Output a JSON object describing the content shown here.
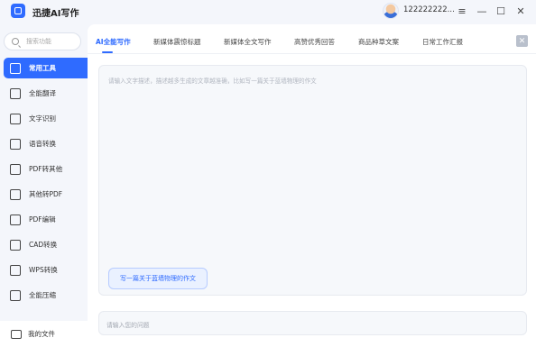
{
  "app": {
    "title": "迅捷AI写作"
  },
  "user": {
    "name": "122222222..."
  },
  "window_controls": {
    "menu": "≡",
    "minimize": "—",
    "maximize": "☐",
    "close": "✕"
  },
  "search": {
    "placeholder": "搜索功能"
  },
  "sidebar": {
    "items": [
      {
        "label": "常用工具",
        "icon": "toolbox-icon",
        "active": true
      },
      {
        "label": "全能翻译",
        "icon": "translate-icon"
      },
      {
        "label": "文字识别",
        "icon": "ocr-icon"
      },
      {
        "label": "语音转换",
        "icon": "voice-icon"
      },
      {
        "label": "PDF转其他",
        "icon": "pdf-icon"
      },
      {
        "label": "其他转PDF",
        "icon": "to-pdf-icon"
      },
      {
        "label": "PDF编辑",
        "icon": "pdf-edit-icon"
      },
      {
        "label": "CAD转换",
        "icon": "cad-icon"
      },
      {
        "label": "WPS转换",
        "icon": "wps-icon"
      },
      {
        "label": "全能压缩",
        "icon": "compress-icon"
      }
    ],
    "my_files": "我的文件"
  },
  "tabs": [
    {
      "label": "AI全能写作",
      "active": true
    },
    {
      "label": "新媒体震惊标题"
    },
    {
      "label": "新媒体全文写作"
    },
    {
      "label": "高赞优秀回答"
    },
    {
      "label": "商品种草文案"
    },
    {
      "label": "日常工作汇报"
    }
  ],
  "editor": {
    "placeholder": "请输入文字描述，描述越多生成的文章越准确，比如写一篇关于蓝墙物理的作文",
    "suggestion": "写一篇关于蓝墙物理的作文"
  },
  "ask": {
    "placeholder": "请输入您的问题"
  },
  "colors": {
    "accent": "#2f6bff",
    "background": "#f4f6fb"
  }
}
